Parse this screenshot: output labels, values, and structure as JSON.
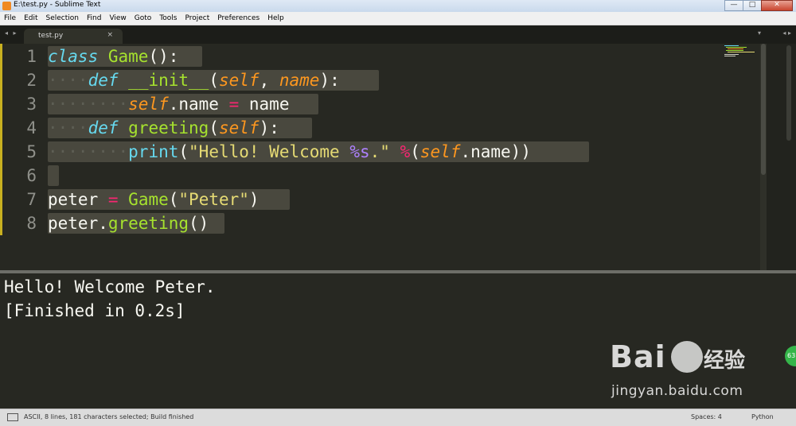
{
  "window": {
    "title": "E:\\test.py - Sublime Text",
    "buttons": {
      "minimize": "—",
      "maximize": "□",
      "close": "✕"
    }
  },
  "menu": [
    "File",
    "Edit",
    "Selection",
    "Find",
    "View",
    "Goto",
    "Tools",
    "Project",
    "Preferences",
    "Help"
  ],
  "tab": {
    "label": "test.py",
    "close": "×"
  },
  "tabbar_glyphs": {
    "left_arrows": "◂ ▸",
    "dropdown": "▾",
    "right_arrows": "◂ ▸"
  },
  "editor": {
    "line_numbers": [
      "1",
      "2",
      "3",
      "4",
      "5",
      "6",
      "7",
      "8"
    ],
    "tokens": {
      "l1": [
        "class",
        " ",
        "Game",
        "():"
      ],
      "l2": [
        "····",
        "def",
        " ",
        "__init__",
        "(",
        "self",
        ", ",
        "name",
        "):"
      ],
      "l3": [
        "········",
        "self",
        ".name ",
        "=",
        " name"
      ],
      "l4": [
        "····",
        "def",
        " ",
        "greeting",
        "(",
        "self",
        "):"
      ],
      "l5": [
        "········",
        "print",
        "(",
        "\"Hello! Welcome ",
        "%s",
        ".\"",
        " ",
        "%",
        "(",
        "self",
        ".name))"
      ],
      "l7": [
        "peter ",
        "=",
        " ",
        "Game",
        "(",
        "\"Peter\"",
        ")"
      ],
      "l8": [
        "peter.",
        "greeting",
        "()"
      ]
    }
  },
  "build_output": {
    "lines": [
      "Hello! Welcome Peter.",
      "[Finished in 0.2s]"
    ]
  },
  "watermark": {
    "brand": "Bai",
    "brand_cn": "经验",
    "url": "jingyan.baidu.com",
    "badge": "63"
  },
  "statusbar": {
    "message": "ASCII, 8 lines, 181 characters selected; Build finished",
    "indentation": "Spaces: 4",
    "syntax": "Python"
  },
  "colors": {
    "background": "#272822",
    "keyword": "#66d9ef",
    "function": "#a6e22e",
    "parameter": "#fd971f",
    "operator": "#f92672",
    "string": "#e6db74",
    "format": "#ae81ff",
    "selection": "#49483e"
  }
}
